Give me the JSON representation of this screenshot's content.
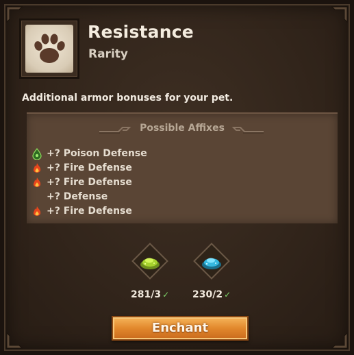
{
  "item": {
    "name": "Resistance",
    "rarity": "Rarity",
    "description": "Additional armor bonuses for your pet.",
    "icon": "paw-print-icon"
  },
  "affixes": {
    "header": "Possible Affixes",
    "items": [
      {
        "icon": "poison-icon",
        "text": "+? Poison Defense"
      },
      {
        "icon": "fire-icon",
        "text": "+? Fire Defense"
      },
      {
        "icon": "fire-icon",
        "text": "+? Fire Defense"
      },
      {
        "icon": "",
        "text": "+? Defense"
      },
      {
        "icon": "fire-icon",
        "text": "+? Fire Defense"
      }
    ]
  },
  "materials": [
    {
      "icon": "green-dust-icon",
      "count": "281/3",
      "color": "#b6e03a"
    },
    {
      "icon": "blue-dust-icon",
      "count": "230/2",
      "color": "#3cc4e8"
    }
  ],
  "enchant_label": "Enchant",
  "colors": {
    "panel": "#32251b",
    "affix_box": "#5a4535",
    "button": "#e2882c",
    "check": "#7fd86b"
  }
}
